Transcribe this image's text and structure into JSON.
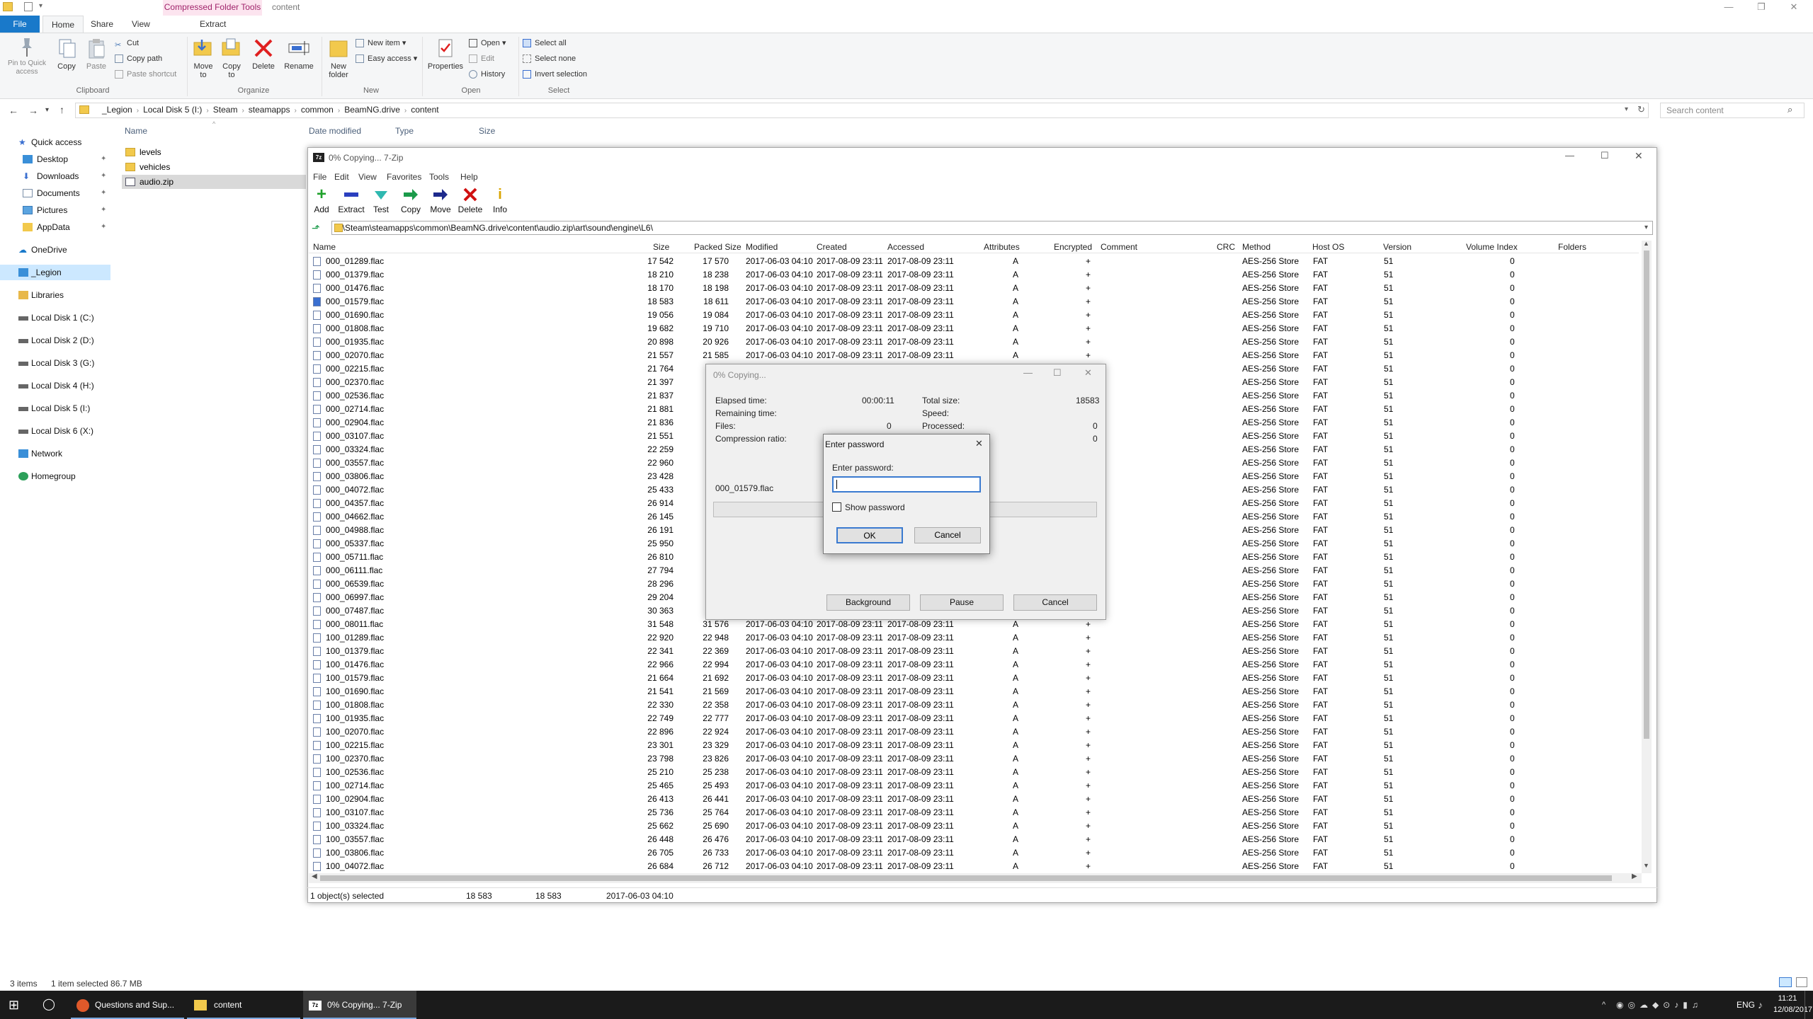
{
  "window": {
    "context_tab": "Compressed Folder Tools",
    "title": "content",
    "controls": [
      "—",
      "❐",
      "✕"
    ]
  },
  "ribbon": {
    "tabs": [
      "File",
      "Home",
      "Share",
      "View"
    ],
    "context_sub_tab": "Extract",
    "clipboard": {
      "pin": "Pin to Quick access",
      "copy": "Copy",
      "paste": "Paste",
      "cut": "Cut",
      "copy_path": "Copy path",
      "paste_shortcut": "Paste shortcut",
      "label": "Clipboard"
    },
    "organize": {
      "move_to": "Move to",
      "copy_to": "Copy to",
      "delete": "Delete",
      "rename": "Rename",
      "label": "Organize"
    },
    "new": {
      "new_folder": "New folder",
      "new_item": "New item",
      "easy_access": "Easy access",
      "label": "New"
    },
    "open": {
      "properties": "Properties",
      "open": "Open",
      "edit": "Edit",
      "history": "History",
      "label": "Open"
    },
    "select": {
      "select_all": "Select all",
      "select_none": "Select none",
      "invert": "Invert selection",
      "label": "Select"
    }
  },
  "address": {
    "crumbs": [
      "_Legion",
      "Local Disk 5 (I:)",
      "Steam",
      "steamapps",
      "common",
      "BeamNG.drive",
      "content"
    ],
    "search_placeholder": "Search content"
  },
  "nav": {
    "items": [
      {
        "label": "Quick access"
      },
      {
        "label": "Desktop"
      },
      {
        "label": "Downloads"
      },
      {
        "label": "Documents"
      },
      {
        "label": "Pictures"
      },
      {
        "label": "AppData"
      },
      {
        "label": "OneDrive"
      },
      {
        "label": "_Legion"
      },
      {
        "label": "Libraries"
      },
      {
        "label": "Local Disk 1 (C:)"
      },
      {
        "label": "Local Disk 2 (D:)"
      },
      {
        "label": "Local Disk 3 (G:)"
      },
      {
        "label": "Local Disk 4 (H:)"
      },
      {
        "label": "Local Disk 5 (I:)"
      },
      {
        "label": "Local Disk 6 (X:)"
      },
      {
        "label": "Network"
      },
      {
        "label": "Homegroup"
      }
    ]
  },
  "filelist": {
    "headers": [
      "Name",
      "Date modified",
      "Type",
      "Size"
    ],
    "items": [
      "levels",
      "vehicles",
      "audio.zip"
    ]
  },
  "status": {
    "items": "3 items",
    "selected": "1 item selected  86.7 MB"
  },
  "taskbar": {
    "apps": [
      "Questions and Sup...",
      "content",
      "0% Copying... 7-Zip"
    ],
    "lang": "ENG",
    "time": "11:21",
    "date": "12/08/2017"
  },
  "zip": {
    "title": "0% Copying... 7-Zip",
    "menu": [
      "File",
      "Edit",
      "View",
      "Favorites",
      "Tools",
      "Help"
    ],
    "tools": [
      "Add",
      "Extract",
      "Test",
      "Copy",
      "Move",
      "Delete",
      "Info"
    ],
    "path": "I:\\Steam\\steamapps\\common\\BeamNG.drive\\content\\audio.zip\\art\\sound\\engine\\L6\\",
    "columns": [
      "Name",
      "Size",
      "Packed Size",
      "Modified",
      "Created",
      "Accessed",
      "Attributes",
      "Encrypted",
      "Comment",
      "CRC",
      "Method",
      "Host OS",
      "Version",
      "Volume Index",
      "Folders"
    ],
    "rows": [
      [
        "000_01289.flac",
        "17 542",
        "17 570",
        "2017-06-03 04:10",
        "2017-08-09 23:11",
        "2017-08-09 23:11"
      ],
      [
        "000_01379.flac",
        "18 210",
        "18 238",
        "2017-06-03 04:10",
        "2017-08-09 23:11",
        "2017-08-09 23:11"
      ],
      [
        "000_01476.flac",
        "18 170",
        "18 198",
        "2017-06-03 04:10",
        "2017-08-09 23:11",
        "2017-08-09 23:11"
      ],
      [
        "000_01579.flac",
        "18 583",
        "18 611",
        "2017-06-03 04:10",
        "2017-08-09 23:11",
        "2017-08-09 23:11"
      ],
      [
        "000_01690.flac",
        "19 056",
        "19 084",
        "2017-06-03 04:10",
        "2017-08-09 23:11",
        "2017-08-09 23:11"
      ],
      [
        "000_01808.flac",
        "19 682",
        "19 710",
        "2017-06-03 04:10",
        "2017-08-09 23:11",
        "2017-08-09 23:11"
      ],
      [
        "000_01935.flac",
        "20 898",
        "20 926",
        "2017-06-03 04:10",
        "2017-08-09 23:11",
        "2017-08-09 23:11"
      ],
      [
        "000_02070.flac",
        "21 557",
        "21 585",
        "2017-06-03 04:10",
        "2017-08-09 23:11",
        "2017-08-09 23:11"
      ],
      [
        "000_02215.flac",
        "21 764",
        "",
        "",
        "",
        ""
      ],
      [
        "000_02370.flac",
        "21 397",
        "",
        "",
        "",
        ""
      ],
      [
        "000_02536.flac",
        "21 837",
        "",
        "",
        "",
        ""
      ],
      [
        "000_02714.flac",
        "21 881",
        "",
        "",
        "",
        ""
      ],
      [
        "000_02904.flac",
        "21 836",
        "",
        "",
        "",
        ""
      ],
      [
        "000_03107.flac",
        "21 551",
        "",
        "",
        "",
        ""
      ],
      [
        "000_03324.flac",
        "22 259",
        "",
        "",
        "",
        ""
      ],
      [
        "000_03557.flac",
        "22 960",
        "",
        "",
        "",
        ""
      ],
      [
        "000_03806.flac",
        "23 428",
        "",
        "",
        "",
        ""
      ],
      [
        "000_04072.flac",
        "25 433",
        "",
        "",
        "",
        ""
      ],
      [
        "000_04357.flac",
        "26 914",
        "",
        "",
        "",
        ""
      ],
      [
        "000_04662.flac",
        "26 145",
        "",
        "",
        "",
        ""
      ],
      [
        "000_04988.flac",
        "26 191",
        "",
        "",
        "",
        ""
      ],
      [
        "000_05337.flac",
        "25 950",
        "",
        "",
        "",
        ""
      ],
      [
        "000_05711.flac",
        "26 810",
        "",
        "",
        "",
        ""
      ],
      [
        "000_06111.flac",
        "27 794",
        "",
        "",
        "",
        ""
      ],
      [
        "000_06539.flac",
        "28 296",
        "",
        "",
        "",
        ""
      ],
      [
        "000_06997.flac",
        "29 204",
        "",
        "",
        "",
        ""
      ],
      [
        "000_07487.flac",
        "30 363",
        "",
        "",
        "",
        ""
      ],
      [
        "000_08011.flac",
        "31 548",
        "31 576",
        "2017-06-03 04:10",
        "2017-08-09 23:11",
        "2017-08-09 23:11"
      ],
      [
        "100_01289.flac",
        "22 920",
        "22 948",
        "2017-06-03 04:10",
        "2017-08-09 23:11",
        "2017-08-09 23:11"
      ],
      [
        "100_01379.flac",
        "22 341",
        "22 369",
        "2017-06-03 04:10",
        "2017-08-09 23:11",
        "2017-08-09 23:11"
      ],
      [
        "100_01476.flac",
        "22 966",
        "22 994",
        "2017-06-03 04:10",
        "2017-08-09 23:11",
        "2017-08-09 23:11"
      ],
      [
        "100_01579.flac",
        "21 664",
        "21 692",
        "2017-06-03 04:10",
        "2017-08-09 23:11",
        "2017-08-09 23:11"
      ],
      [
        "100_01690.flac",
        "21 541",
        "21 569",
        "2017-06-03 04:10",
        "2017-08-09 23:11",
        "2017-08-09 23:11"
      ],
      [
        "100_01808.flac",
        "22 330",
        "22 358",
        "2017-06-03 04:10",
        "2017-08-09 23:11",
        "2017-08-09 23:11"
      ],
      [
        "100_01935.flac",
        "22 749",
        "22 777",
        "2017-06-03 04:10",
        "2017-08-09 23:11",
        "2017-08-09 23:11"
      ],
      [
        "100_02070.flac",
        "22 896",
        "22 924",
        "2017-06-03 04:10",
        "2017-08-09 23:11",
        "2017-08-09 23:11"
      ],
      [
        "100_02215.flac",
        "23 301",
        "23 329",
        "2017-06-03 04:10",
        "2017-08-09 23:11",
        "2017-08-09 23:11"
      ],
      [
        "100_02370.flac",
        "23 798",
        "23 826",
        "2017-06-03 04:10",
        "2017-08-09 23:11",
        "2017-08-09 23:11"
      ],
      [
        "100_02536.flac",
        "25 210",
        "25 238",
        "2017-06-03 04:10",
        "2017-08-09 23:11",
        "2017-08-09 23:11"
      ],
      [
        "100_02714.flac",
        "25 465",
        "25 493",
        "2017-06-03 04:10",
        "2017-08-09 23:11",
        "2017-08-09 23:11"
      ],
      [
        "100_02904.flac",
        "26 413",
        "26 441",
        "2017-06-03 04:10",
        "2017-08-09 23:11",
        "2017-08-09 23:11"
      ],
      [
        "100_03107.flac",
        "25 736",
        "25 764",
        "2017-06-03 04:10",
        "2017-08-09 23:11",
        "2017-08-09 23:11"
      ],
      [
        "100_03324.flac",
        "25 662",
        "25 690",
        "2017-06-03 04:10",
        "2017-08-09 23:11",
        "2017-08-09 23:11"
      ],
      [
        "100_03557.flac",
        "26 448",
        "26 476",
        "2017-06-03 04:10",
        "2017-08-09 23:11",
        "2017-08-09 23:11"
      ],
      [
        "100_03806.flac",
        "26 705",
        "26 733",
        "2017-06-03 04:10",
        "2017-08-09 23:11",
        "2017-08-09 23:11"
      ],
      [
        "100_04072.flac",
        "26 684",
        "26 712",
        "2017-06-03 04:10",
        "2017-08-09 23:11",
        "2017-08-09 23:11"
      ]
    ],
    "const": {
      "attr": "A",
      "enc": "+",
      "method": "AES-256 Store",
      "host": "FAT",
      "version": "51",
      "volume": "0"
    },
    "selected_name": "000_01579.flac",
    "status": {
      "selected": "1 object(s) selected",
      "size": "18 583",
      "packed": "18 583",
      "modified": "2017-06-03 04:10"
    }
  },
  "progress": {
    "title": "0% Copying...",
    "elapsed_label": "Elapsed time:",
    "elapsed": "00:00:11",
    "remaining_label": "Remaining time:",
    "files_label": "Files:",
    "files": "0",
    "ratio_label": "Compression ratio:",
    "total_label": "Total size:",
    "total": "18583",
    "speed_label": "Speed:",
    "processed_label": "Processed:",
    "processed": "0",
    "progress": 0,
    "current_file": "000_01579.flac",
    "buttons": [
      "Background",
      "Pause",
      "Cancel"
    ]
  },
  "password": {
    "title": "Enter password",
    "label": "Enter password:",
    "value": "",
    "show_label": "Show password",
    "ok": "OK",
    "cancel": "Cancel"
  },
  "colors": {
    "accent": "#1979ca",
    "selection": "#cce8ff",
    "context_tab": "#fce4ef",
    "taskbar": "#1b1b1b"
  }
}
